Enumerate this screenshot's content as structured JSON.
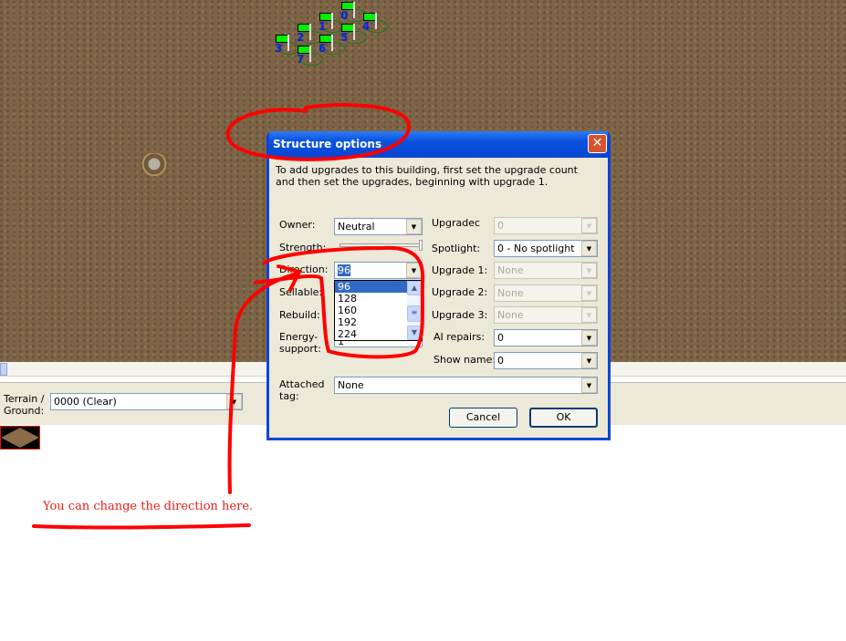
{
  "map": {
    "waypoints": [
      "0",
      "1",
      "2",
      "3",
      "4",
      "5",
      "6",
      "7"
    ]
  },
  "bottom_panel": {
    "terrain_label": "Terrain /\nGround:",
    "terrain_value": "0000 (Clear)"
  },
  "dialog": {
    "title": "Structure options",
    "intro": "To add upgrades to this building, first set the upgrade count and then set the upgrades, beginning with upgrade 1.",
    "owner_label": "Owner:",
    "owner_value": "Neutral",
    "strength_label": "Strength:",
    "direction_label": "Direction:",
    "direction_value": "96",
    "direction_options": [
      "96",
      "128",
      "160",
      "192",
      "224"
    ],
    "sellable_label": "Sellable:",
    "rebuild_label": "Rebuild:",
    "energy_label": "Energy-\nsupport:",
    "energy_value": "1",
    "upgrades_label": "Upgradec",
    "upgrades_value": "0",
    "spotlight_label": "Spotlight:",
    "spotlight_value": "0 - No spotlight",
    "upgrade1_label": "Upgrade 1:",
    "upgrade1_value": "None",
    "upgrade2_label": "Upgrade 2:",
    "upgrade2_value": "None",
    "upgrade3_label": "Upgrade 3:",
    "upgrade3_value": "None",
    "ai_repairs_label": "AI repairs:",
    "ai_repairs_value": "0",
    "show_name_label": "Show name:",
    "show_name_value": "0",
    "tag_label": "Attached\ntag:",
    "tag_value": "None",
    "cancel": "Cancel",
    "ok": "OK"
  },
  "annotation": {
    "text": "You can change the direction here.",
    "color": "#e8201a"
  }
}
